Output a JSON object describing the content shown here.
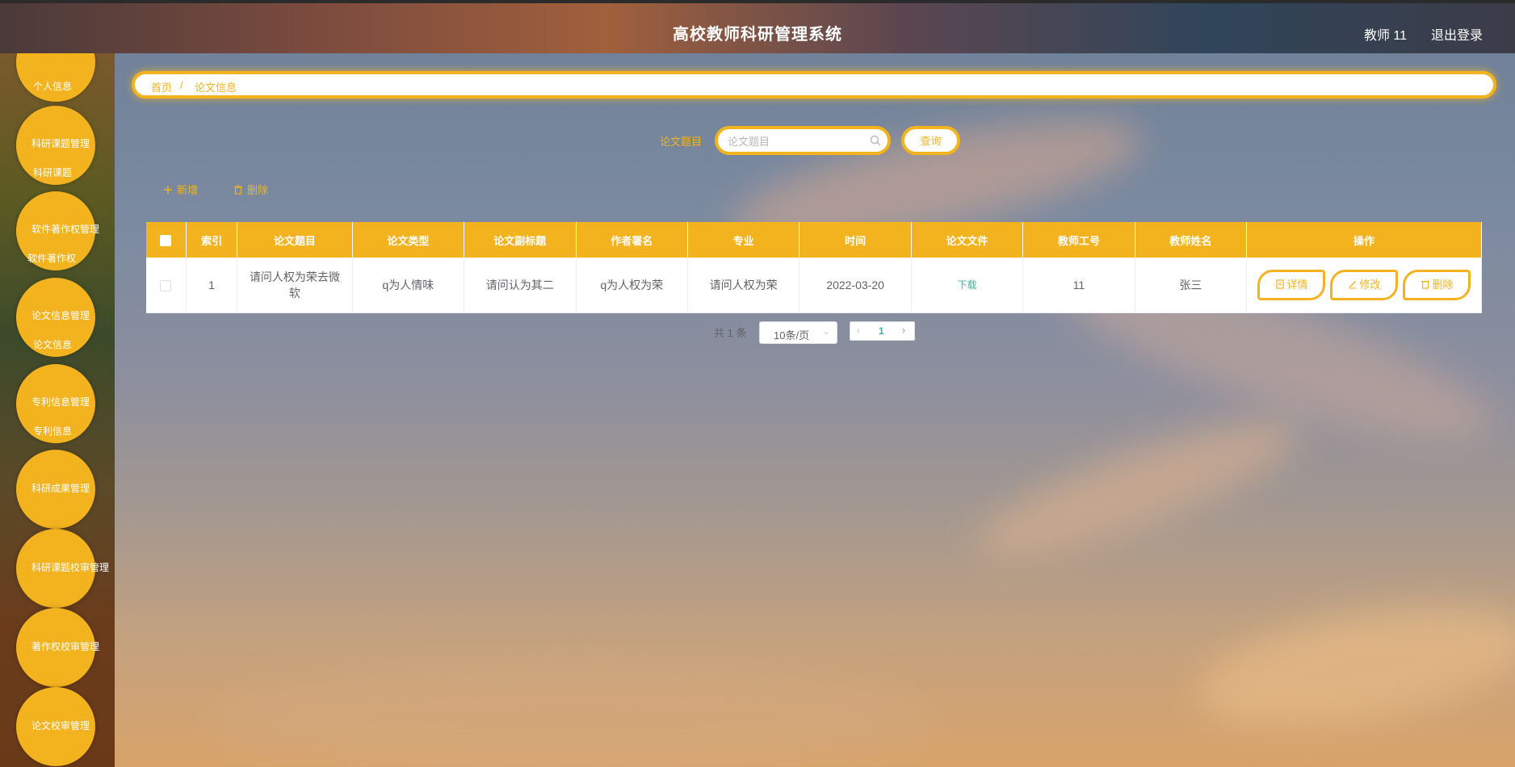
{
  "header": {
    "title": "高校教师科研管理系统",
    "user": "教师 11",
    "logout": "退出登录"
  },
  "sidebar": {
    "items": [
      {
        "label": "个人信息"
      },
      {
        "label": "科研课题管理",
        "sub": "科研课题"
      },
      {
        "label": "软件著作权管理",
        "sub": "软件著作权"
      },
      {
        "label": "论文信息管理",
        "sub": "论文信息"
      },
      {
        "label": "专利信息管理",
        "sub": "专利信息"
      },
      {
        "label": "科研成果管理"
      },
      {
        "label": "科研课题校审管理"
      },
      {
        "label": "著作权校审管理"
      },
      {
        "label": "论文校审管理"
      }
    ]
  },
  "breadcrumb": {
    "home": "首页",
    "separator": "/",
    "current": "论文信息"
  },
  "search": {
    "label": "论文题目",
    "placeholder": "论文题目",
    "button": "查询"
  },
  "actions": {
    "add": "新增",
    "delete": "删除"
  },
  "table": {
    "columns": [
      "索引",
      "论文题目",
      "论文类型",
      "论文副标题",
      "作者署名",
      "专业",
      "时间",
      "论文文件",
      "教师工号",
      "教师姓名",
      "操作"
    ],
    "rows": [
      {
        "index": "1",
        "title": "请问人权为荣去微软",
        "type": "q为人情味",
        "subtitle": "请问认为其二",
        "author": "q为人权为荣",
        "major": "请问人权为荣",
        "time": "2022-03-20",
        "file": "下载",
        "teacher_id": "11",
        "teacher_name": "张三"
      }
    ],
    "row_actions": {
      "detail": "详情",
      "edit": "修改",
      "delete": "删除"
    }
  },
  "pagination": {
    "total": "共 1 条",
    "page_size": "10条/页",
    "current_page": "1"
  },
  "colors": {
    "accent": "#f2b31f",
    "link_green": "#3cb39a"
  }
}
